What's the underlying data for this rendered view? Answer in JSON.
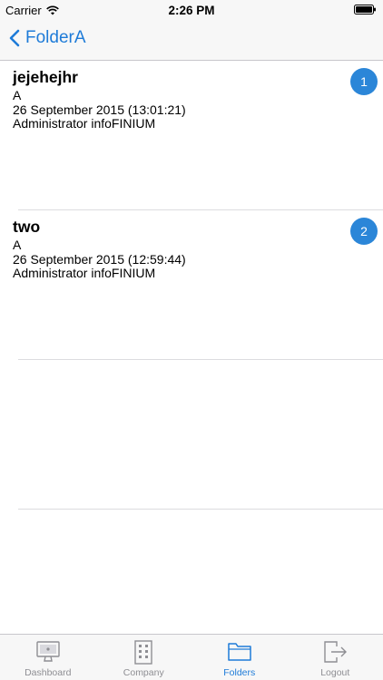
{
  "status": {
    "carrier": "Carrier",
    "time": "2:26 PM"
  },
  "nav": {
    "back_label": "FolderA"
  },
  "items": [
    {
      "title": "jejehejhr",
      "subtitle": "A",
      "date": "26 September 2015 (13:01:21)",
      "author": "Administrator infoFINIUM",
      "badge": "1"
    },
    {
      "title": "two",
      "subtitle": "A",
      "date": "26 September 2015 (12:59:44)",
      "author": "Administrator infoFINIUM",
      "badge": "2"
    }
  ],
  "tabs": [
    {
      "label": "Dashboard",
      "icon": "monitor-icon"
    },
    {
      "label": "Company",
      "icon": "building-icon"
    },
    {
      "label": "Folders",
      "icon": "folder-icon"
    },
    {
      "label": "Logout",
      "icon": "logout-icon"
    }
  ],
  "colors": {
    "accent": "#1e7bd8",
    "badge": "#2b86d8",
    "inactive": "#8e8e93",
    "bar_bg": "#f7f7f7"
  }
}
